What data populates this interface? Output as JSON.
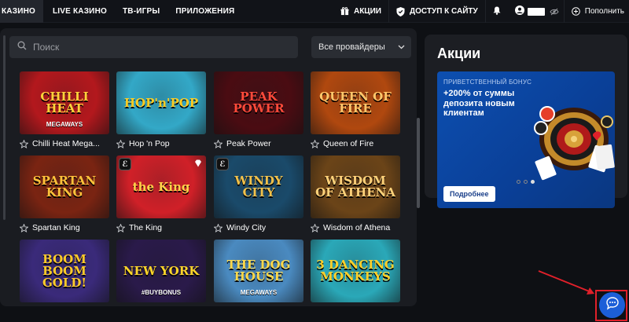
{
  "nav": {
    "items": [
      "КАЗИНО",
      "LIVE КАЗИНО",
      "ТВ-ИГРЫ",
      "ПРИЛОЖЕНИЯ"
    ],
    "promotions": "АКЦИИ",
    "site_access": "ДОСТУП К САЙТУ",
    "top_up": "Пополнить"
  },
  "search": {
    "placeholder": "Поиск"
  },
  "provider": {
    "selected": "Все провайдеры"
  },
  "games": [
    {
      "name": "Chilli Heat Mega...",
      "art": "CHILLI HEAT",
      "sub": "MEGAWAYS",
      "bg": "#b3181d",
      "fg": "#ffd23a"
    },
    {
      "name": "Hop 'n Pop",
      "art": "HOP'n'POP",
      "sub": "",
      "bg": "#33a8c7",
      "fg": "#ffcc22"
    },
    {
      "name": "Peak Power",
      "art": "PEAK POWER",
      "sub": "",
      "bg": "#4a0c12",
      "fg": "#ff4a3a"
    },
    {
      "name": "Queen of Fire",
      "art": "QUEEN OF FIRE",
      "sub": "",
      "bg": "#b0480f",
      "fg": "#ffc76b"
    },
    {
      "name": "Spartan King",
      "art": "SPARTAN KING",
      "sub": "",
      "bg": "#7a2412",
      "fg": "#ffc23a"
    },
    {
      "name": "The King",
      "art": "the King",
      "sub": "",
      "bg": "#d02028",
      "fg": "#ffd34a"
    },
    {
      "name": "Windy City",
      "art": "WINDY CITY",
      "sub": "",
      "bg": "#1a4a6a",
      "fg": "#f2c14a"
    },
    {
      "name": "Wisdom of Athena",
      "art": "WISDOM OF ATHENA",
      "sub": "",
      "bg": "#6b4418",
      "fg": "#ffd27a"
    },
    {
      "name": "",
      "art": "BOOM BOOM GOLD!",
      "sub": "",
      "bg": "#3a2a7a",
      "fg": "#ffcb2a"
    },
    {
      "name": "",
      "art": "NEW YORK",
      "sub": "#BUYBONUS",
      "bg": "#2a1a4a",
      "fg": "#ffd62a"
    },
    {
      "name": "",
      "art": "THE DOG HOUSE",
      "sub": "MEGAWAYS",
      "bg": "#4a8ac0",
      "fg": "#ffd94a"
    },
    {
      "name": "",
      "art": "3 DANCING MONKEYS",
      "sub": "",
      "bg": "#2aa8b8",
      "fg": "#ffd02a"
    }
  ],
  "promo": {
    "title": "Акции",
    "label": "ПРИВЕТСТВЕННЫЙ БОНУС",
    "text": "+200% от суммы депозита новым клиентам",
    "button": "Подробнее"
  },
  "colors": {
    "accent": "#1c5fd8",
    "highlight": "#e0202a",
    "banner": "#0d4fb0"
  }
}
